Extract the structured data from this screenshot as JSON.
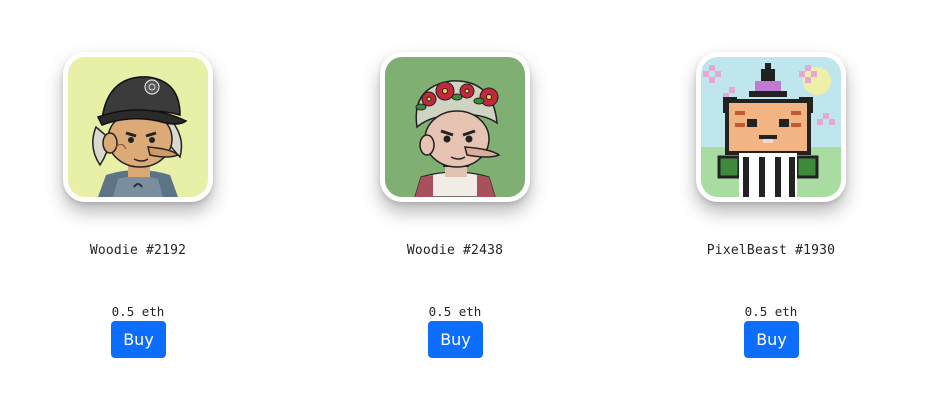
{
  "colors": {
    "button_bg": "#0d6efd",
    "button_text": "#ffffff",
    "text": "#212529"
  },
  "items": [
    {
      "name": "Woodie #2192",
      "price": "0.5 eth",
      "buy_label": "Buy",
      "image_icon": "woodie-portrait-icon"
    },
    {
      "name": "Woodie #2438",
      "price": "0.5 eth",
      "buy_label": "Buy",
      "image_icon": "woodie-portrait-icon"
    },
    {
      "name": "PixelBeast #1930",
      "price": "0.5 eth",
      "buy_label": "Buy",
      "image_icon": "pixelbeast-portrait-icon"
    }
  ]
}
